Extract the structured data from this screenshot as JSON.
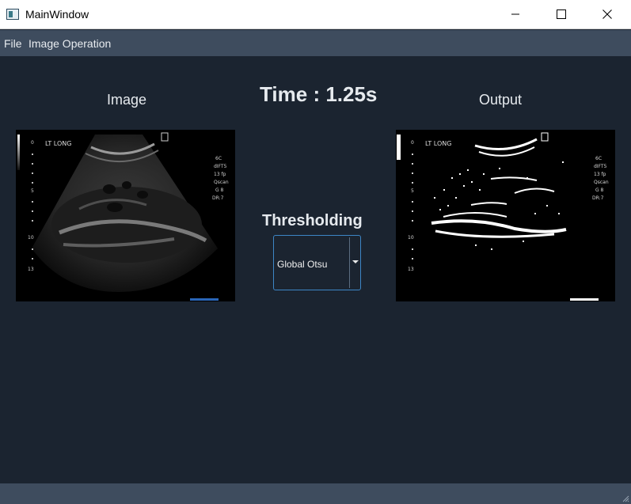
{
  "window": {
    "title": "MainWindow",
    "icon": "app-window-icon"
  },
  "menu": {
    "items": [
      "File",
      "Image Operation"
    ]
  },
  "labels": {
    "input_title": "Image",
    "output_title": "Output",
    "time": "Time : 1.25s",
    "thresholding": "Thresholding"
  },
  "input_panel": {
    "caption": "LT LONG"
  },
  "output_panel": {
    "caption": "LT LONG"
  },
  "threshold_combo": {
    "selected": "Global Otsu"
  },
  "colors": {
    "background": "#1b2430",
    "menubar": "#3e4c5e",
    "accent": "#3d86c6"
  }
}
